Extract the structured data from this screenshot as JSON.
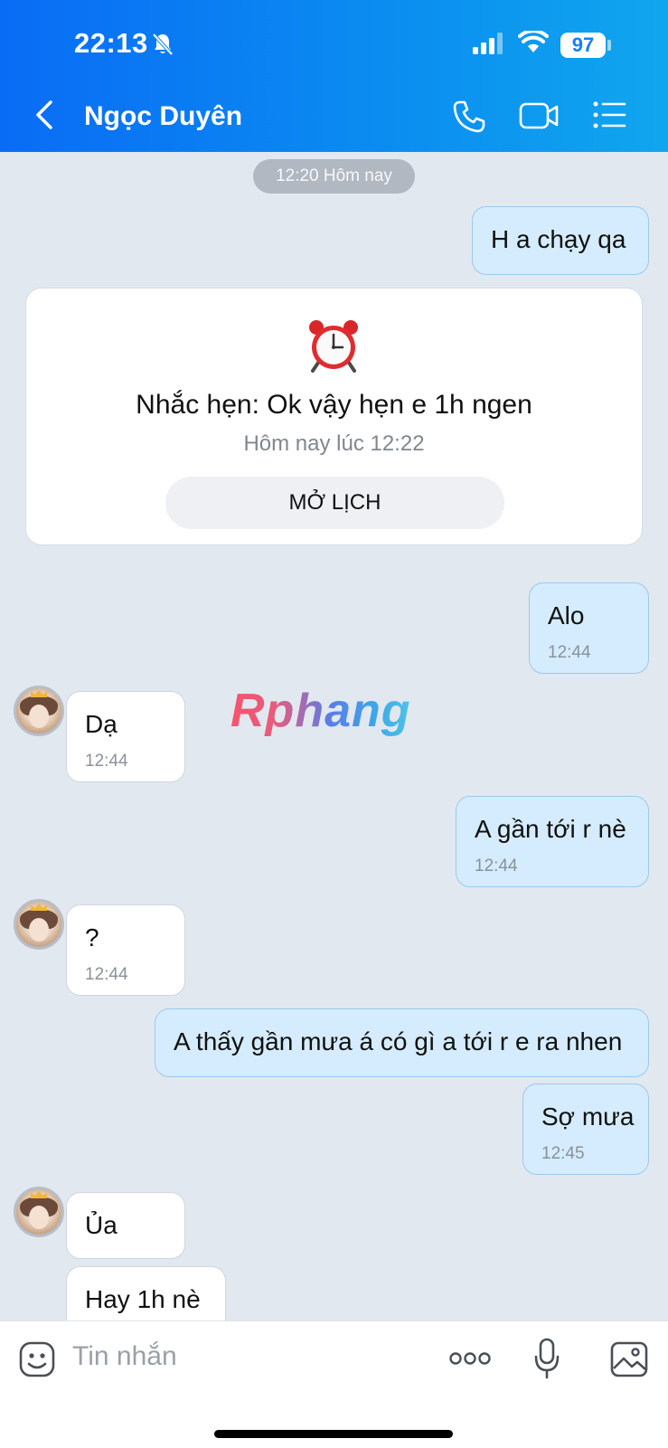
{
  "status_bar": {
    "time": "22:13",
    "battery": "97"
  },
  "header": {
    "contact_name": "Ngọc Duyên"
  },
  "chat": {
    "date_pill": "12:20 Hôm nay",
    "reminder": {
      "title": "Nhắc hẹn: Ok vậy hẹn e 1h ngen",
      "subtitle": "Hôm nay lúc 12:22",
      "button_label": "MỞ LỊCH"
    },
    "messages": [
      {
        "direction": "sent",
        "text": "H a chạy qa",
        "time": ""
      },
      {
        "direction": "sent",
        "text": "Alo",
        "time": "12:44"
      },
      {
        "direction": "received",
        "text": "Dạ",
        "time": "12:44"
      },
      {
        "direction": "sent",
        "text": "A gần tới r nè",
        "time": "12:44"
      },
      {
        "direction": "received",
        "text": "?",
        "time": "12:44"
      },
      {
        "direction": "sent",
        "text": "A thấy gần mưa á có gì a tới r e ra nhen",
        "time": ""
      },
      {
        "direction": "sent",
        "text": "Sợ mưa",
        "time": "12:45"
      },
      {
        "direction": "received",
        "text": "Ủa",
        "time": ""
      },
      {
        "direction": "received",
        "text": "Hay 1h nè",
        "time": ""
      }
    ],
    "watermark": "Rphang"
  },
  "composer": {
    "placeholder": "Tin nhắn"
  },
  "colors": {
    "header_start": "#0a6cf5",
    "header_end": "#10a6ee",
    "sent_bubble": "#d4ecfd",
    "received_bubble": "#ffffff",
    "chat_bg": "#e2e8f0"
  }
}
